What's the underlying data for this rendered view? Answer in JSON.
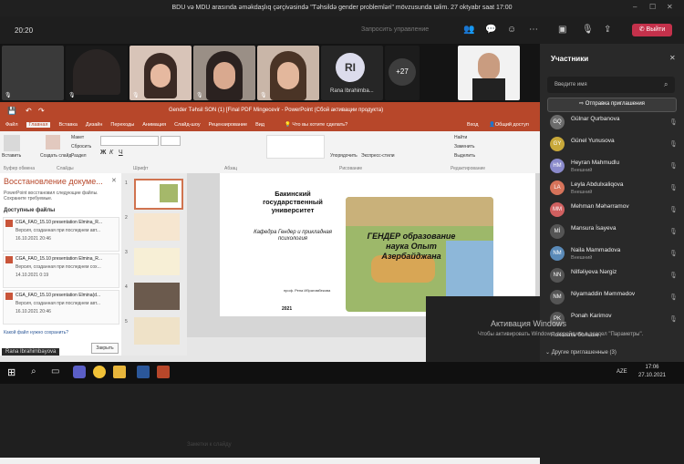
{
  "window": {
    "title": "BDU və MDU arasında əməkdaşlıq çərçivəsində \"Təhsildə gender problemləri\" mövzusunda təlim. 27 oktyabr saat 17:00"
  },
  "meeting": {
    "timer": "20:20",
    "request_control": "Запросить управление",
    "leave_label": "Выйти",
    "icons": [
      "people-icon",
      "chat-icon",
      "reactions-icon",
      "more-icon",
      "camera-off-icon",
      "mic-off-icon",
      "share-icon",
      "leave-phone-icon"
    ]
  },
  "video_strip": {
    "overflow_count": "+27",
    "initials_tile": {
      "initials": "RI",
      "name": "Rana Ibrahimba..."
    }
  },
  "participants_panel": {
    "title": "Участники",
    "search_placeholder": "Введите имя",
    "invite_label": "Отправка приглашения",
    "people": [
      {
        "name": "Gülnar Qurbanova",
        "sub": "",
        "initials": "GQ",
        "color": "#6b6b6b"
      },
      {
        "name": "Günel Yunusova",
        "sub": "",
        "initials": "GY",
        "color": "#c8a83a"
      },
      {
        "name": "Heyran Mahmudlu",
        "sub": "Внешний",
        "initials": "HM",
        "color": "#8a8acb"
      },
      {
        "name": "Leyla Abdulxaliqova",
        "sub": "Внешний",
        "initials": "LA",
        "color": "#d6735a"
      },
      {
        "name": "Mehman Məhərramov",
        "sub": "",
        "initials": "MM",
        "color": "#d06060"
      },
      {
        "name": "Mansura İsayeva",
        "sub": "",
        "initials": "Mİ",
        "color": "#555"
      },
      {
        "name": "Naila Mammadova",
        "sub": "Внешний",
        "initials": "NM",
        "color": "#5a8ab8"
      },
      {
        "name": "Nilfəliyeva Nərgiz",
        "sub": "",
        "initials": "NN",
        "color": "#555"
      },
      {
        "name": "Niyamaddin Məmmədov",
        "sub": "",
        "initials": "NM",
        "color": "#555"
      },
      {
        "name": "Ponah Karimov",
        "sub": "",
        "initials": "PK",
        "color": "#555"
      }
    ],
    "show_more": "Показать больше",
    "other_invites": "Другие приглашенные (3)"
  },
  "powerpoint": {
    "title": "Gender Təhsil SON (1) [Final PDF Mingecevir - PowerPoint (Сбой активации продукта)",
    "login": "Вход",
    "share": "Общий доступ",
    "tabs": [
      "Файл",
      "Главная",
      "Вставка",
      "Дизайн",
      "Переходы",
      "Анимация",
      "Слайд-шоу",
      "Рецензирование",
      "Вид"
    ],
    "tell_me": "Что вы хотите сделать?",
    "ribbon_groups": [
      "Буфер обмена",
      "Слайды",
      "Шрифт",
      "Абзац",
      "Рисование",
      "Редактирование"
    ],
    "ribbon_buttons": [
      "Вставить",
      "Создать слайд",
      "Макет",
      "Сбросить",
      "Раздел",
      "Упорядочить",
      "Экспресс-стили",
      "Найти",
      "Заменить",
      "Выделить"
    ],
    "recovery": {
      "title": "Восстановление докуме...",
      "desc": "PowerPoint восстановил следующие файлы. Сохраните требуемые.",
      "available": "Доступные файлы",
      "files": [
        {
          "name": "CGA_FAO_15.10 presentation Elmina_R...",
          "desc": "Версия, созданная при последнем авт...",
          "date": "16.10.2021 20:46"
        },
        {
          "name": "CGA_FAO_15.10 presentation Elmina_R...",
          "desc": "Версия, созданная при последнем сох...",
          "date": "14.10.2021 0:19"
        },
        {
          "name": "CGA_FAO_15.10 presentation Elmina(d...",
          "desc": "Версия, созданная при последнем авт...",
          "date": "16.10.2021 20:46"
        }
      ],
      "which_file": "Какой файл нужно сохранить?",
      "close": "Закрыть"
    },
    "slide": {
      "university": "Бакинский государственный университет",
      "dept": "Кафедра Гендер и прикладная психология",
      "map_text": "ГЕНДЕР образование наука Опыт Азербайджана",
      "author": "проф. Рена Ибрагимбекова",
      "year": "2021"
    },
    "notes": "Заметки к слайду",
    "status_name": "Rana Ibrahimbayova"
  },
  "activation": {
    "title": "Активация Windows",
    "desc": "Чтобы активировать Windows, перейдите в раздел \"Параметры\"."
  },
  "taskbar": {
    "time": "17:06",
    "date": "27.10.2021",
    "lang": "AZE"
  }
}
